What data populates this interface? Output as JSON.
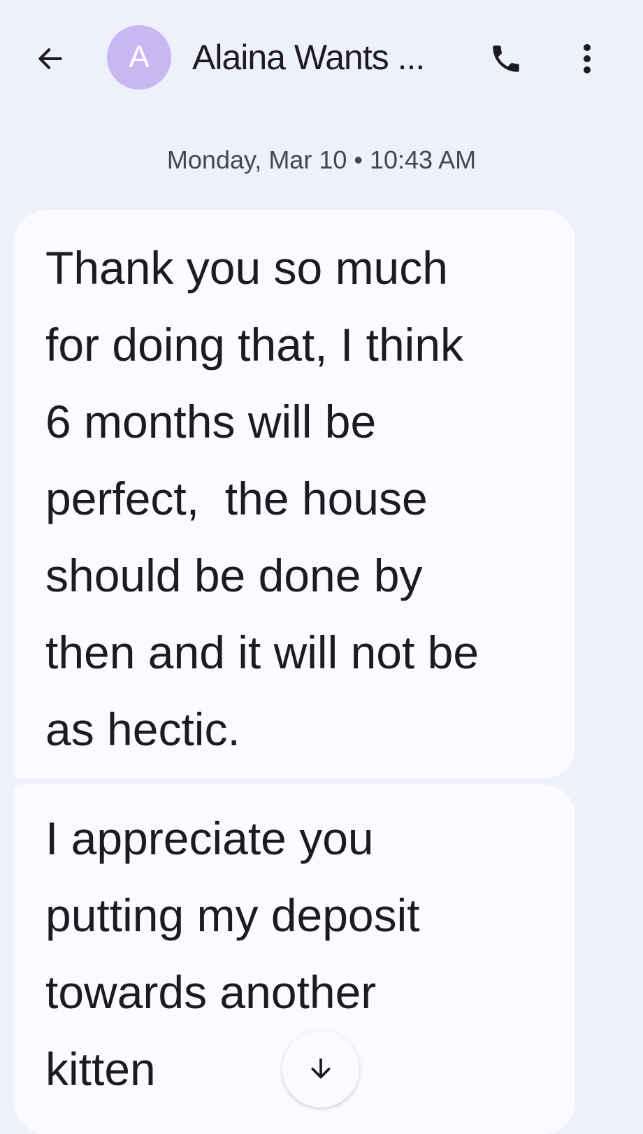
{
  "header": {
    "back_icon": "arrow-left-icon",
    "avatar_letter": "A",
    "avatar_color": "#c8b8f2",
    "title": "Alaina Wants ...",
    "call_icon": "phone-icon",
    "more_icon": "more-vertical-icon"
  },
  "conversation": {
    "timestamp": "Monday, Mar 10 • 10:43 AM",
    "messages": [
      {
        "text": "Thank you so much\nfor doing that, I think\n6 months will be\nperfect,  the house\nshould be done by\nthen and it will not be\nas hectic."
      },
      {
        "text": "I appreciate you\nputting my deposit\ntowards another\nkitten"
      }
    ]
  },
  "scroll_button": {
    "icon": "arrow-down-icon"
  },
  "colors": {
    "background": "#eef0fb",
    "bubble": "#fbfaff",
    "text": "#1c1b1f"
  }
}
